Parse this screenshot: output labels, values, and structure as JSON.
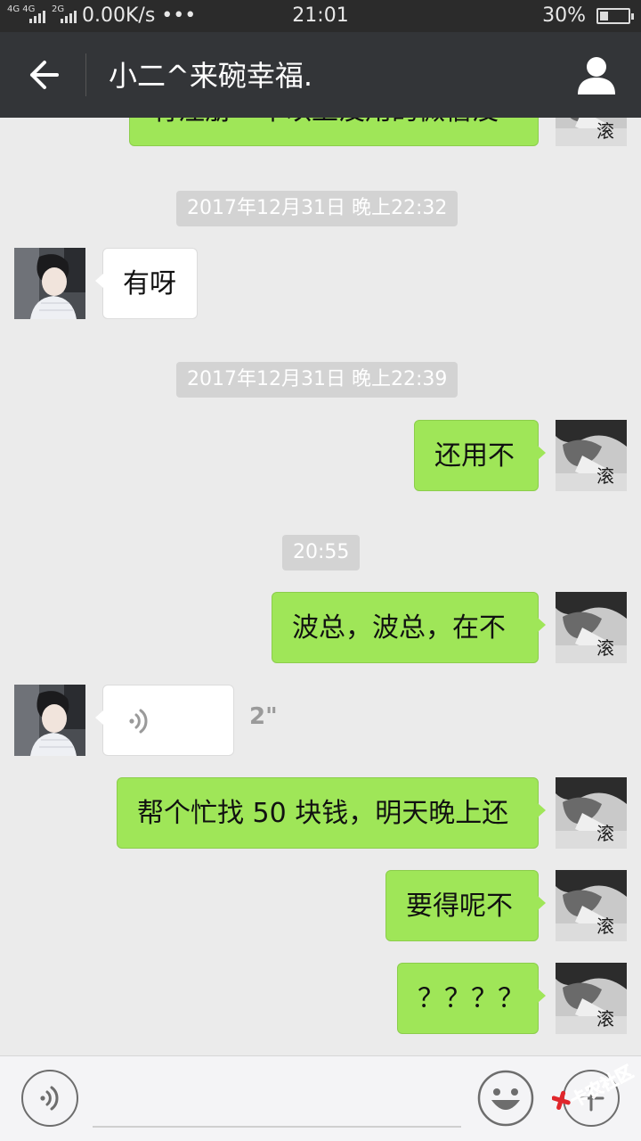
{
  "status_bar": {
    "network_left": "4G 4G",
    "network_right": "2G",
    "speed": "0.00K/s •••",
    "time": "21:01",
    "battery_percent_label": "30%",
    "battery_level": 0.3
  },
  "header": {
    "title": "小二^来碗幸福.",
    "back_icon": "back-arrow-icon",
    "profile_icon": "user-profile-icon"
  },
  "messages": {
    "m0": {
      "text": "有注册一年以上没用的微信没"
    },
    "ts1": "2017年12月31日 晚上22:32",
    "m1": {
      "text": "有呀"
    },
    "ts2": "2017年12月31日 晚上22:39",
    "m2": {
      "text": "还用不"
    },
    "ts3": "20:55",
    "m3": {
      "text": "波总，波总，在不"
    },
    "m4": {
      "duration": "2\""
    },
    "m5": {
      "text": "帮个忙找 50 块钱，明天晚上还"
    },
    "m6": {
      "text": "要得呢不"
    },
    "m7": {
      "text": "？？？？"
    }
  },
  "avatar_my_char": "滚",
  "input_bar": {
    "placeholder": "",
    "voice_icon": "voice-input-icon",
    "emoji_icon": "emoji-icon",
    "plus_icon": "plus-icon"
  },
  "watermark_text": "卡农社区",
  "colors": {
    "my_bubble": "#9fe658",
    "their_bubble": "#ffffff",
    "header_bg": "#333538",
    "chat_bg": "#ebebeb"
  }
}
